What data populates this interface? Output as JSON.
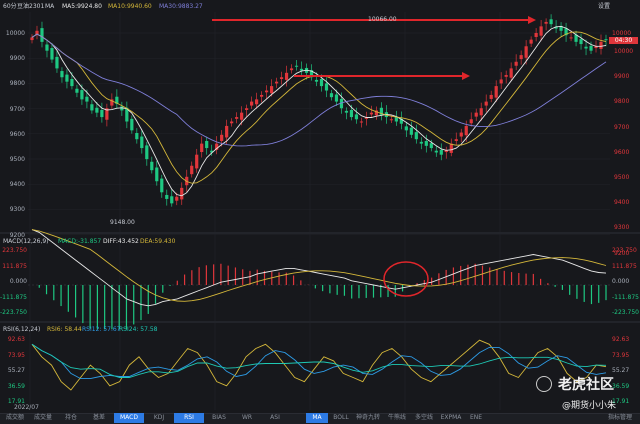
{
  "header": {
    "period": "60分",
    "symbol": "豆油2301",
    "indicator": "MA",
    "ma5": "MA5:9924.80",
    "ma10": "MA10:9940.60",
    "ma30": "MA30:9883.27",
    "settings": "设置",
    "price_tag_high": "10000",
    "price_tag_time": "04:30"
  },
  "price_axis": {
    "left": [
      "10000",
      "9900",
      "9800",
      "9700",
      "9600",
      "9500",
      "9400",
      "9300",
      "9200"
    ],
    "right": [
      "10000",
      "9900",
      "9800",
      "9700",
      "9600",
      "9500",
      "9400",
      "9300",
      "9200"
    ]
  },
  "annotations": {
    "high_label": "10066.00",
    "low_label": "9148.00"
  },
  "macd": {
    "title": "MACD(12,26,9)",
    "value": "MACD:-31.857",
    "diff": "DIFF:43.452",
    "dea": "DEA:59.430",
    "axis": [
      "223.750",
      "111.875",
      "0.000",
      "-111.875",
      "-223.750"
    ]
  },
  "rsi": {
    "title": "RSI(6,12,24)",
    "rsi6": "RSI6: 58.44",
    "rsi12": "RSI12: 57.67",
    "rsi24": "RSI24: 57.58",
    "axis": [
      "92.63",
      "73.95",
      "55.27",
      "36.59",
      "17.91"
    ]
  },
  "date_label": "2022/07",
  "bottom_tabs": [
    "成交额",
    "成交量",
    "持仓",
    "基差",
    "MACD",
    "KDJ",
    "RSI",
    "BIAS",
    "WR",
    "ASI"
  ],
  "bottom_tabs_right": [
    "MA",
    "BOLL",
    "神奇九转",
    "牛熊线",
    "多空线",
    "EXPMA",
    "ENE"
  ],
  "bottom_tools": "指标管理",
  "watermark": {
    "brand": "老虎社区",
    "user": "@期货小小朱"
  },
  "colors": {
    "up": "#e0363b",
    "down": "#1ec882",
    "ma5": "#e8e8e8",
    "ma10": "#d4b73a",
    "ma30": "#7f7fd9",
    "accent": "#2d7be5"
  }
}
